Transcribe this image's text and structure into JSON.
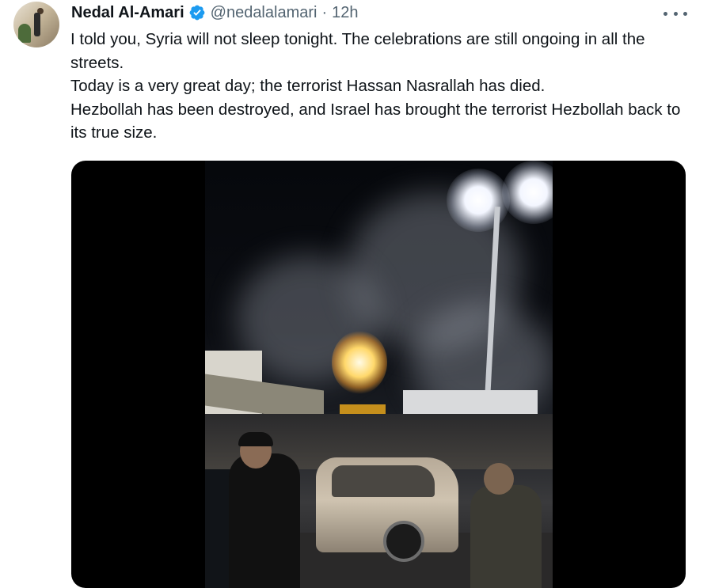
{
  "tweet": {
    "author": {
      "name": "Nedal Al-Amari",
      "handle": "@nedalalamari",
      "verified": true,
      "avatar_icon": "avatar-photo"
    },
    "separator": "·",
    "time": "12h",
    "more_icon": "more-options-icon",
    "text_lines": [
      "I told you, Syria will not sleep tonight. The celebrations are still ongoing in all the streets.",
      "Today is a very great day; the terrorist Hassan Nasrallah has died.",
      "Hezbollah has been destroyed, and Israel has brought the terrorist Hezbollah back to its true size."
    ],
    "media": {
      "type": "video"
    }
  },
  "colors": {
    "text": "#0f1419",
    "secondary": "#536471",
    "verified_blue": "#1d9bf0",
    "media_background": "#000000"
  }
}
